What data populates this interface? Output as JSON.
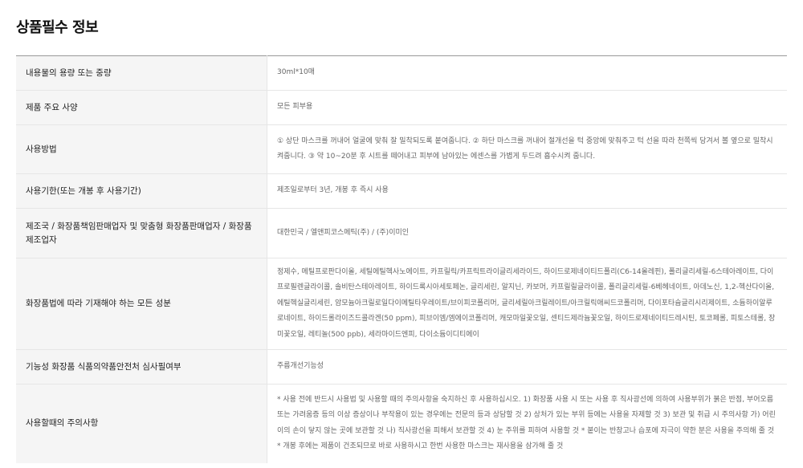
{
  "page": {
    "title": "상품필수 정보"
  },
  "rows": [
    {
      "label": "내용물의 용량 또는 중량",
      "value": "30ml*10매"
    },
    {
      "label": "제품 주요 사양",
      "value": "모든 피부용"
    },
    {
      "label": "사용방법",
      "value": "① 상단 마스크를 꺼내어 얼굴에 맞춰 잘 밀착되도록 붙여줍니다. ② 하단 마스크를 꺼내어 절개선을 턱 중앙에 맞춰주고 턱 선을 따라 천쪽씩 당겨서 볼 옆으로 밀착시켜줍니다. ③ 약 10~20분 후 시트를 떼어내고 피부에 남아있는 에센스를 가볍게 두드려 흡수시켜 줍니다."
    },
    {
      "label": "사용기한(또는 개봉 후 사용기간)",
      "value": "제조일로부터 3년, 개봉 후 즉시 사용"
    },
    {
      "label": "제조국 / 화장품책임판매업자 및 맞춤형 화장품판매업자 / 화장품제조업자",
      "value": "대한민국 / 엘앤피코스메틱(주) / (주)이미인"
    },
    {
      "label": "화장품법에 따라 기재해야 하는 모든 성분",
      "value": "정제수, 메틸프로판다이올, 세틸에틸헥사노에이트, 카프릴릭/카프릭트라이글리세라이드, 하이드로제네이티드폴리(C6-14올레핀), 폴리글리세릴-6스테아레이트, 다이프로필렌글라이콜, 솔비탄스테아레이트, 하이드록시아세토페논, 글리세린, 알지닌, 카보머, 카프릴릴글라이콜, 폴리글리세릴-6베헤네이트, 아데노신, 1,2-헥산다이올, 에틸헥실글리세린, 암모늄아크릴로일다이메틸타우레이트/브이피코폴리머, 글리세릴아크릴레이트/아크릴릭애씨드코폴리머, 다이포타슘글리시리제이트, 소듐하이알루로네이트, 하이드롤라이즈드콜라겐(50 ppm), 피브이엠/엠에이코폴리머, 캐모마일꽃오일, 센티드제라늄꽃오일, 하이드로제네이티드레시틴, 토코페롤, 피토스테롤, 장미꽃오일, 레티놀(500 ppb), 세라마이드엔피, 다이소듐이디티에이"
    },
    {
      "label": "기능성 화장품 식품의약품안전처 심사필여부",
      "value": "주름개선기능성"
    },
    {
      "label": "사용할때의 주의사항",
      "value": "* 사용 전에 반드시 사용법 및 사용할 때의 주의사항을 숙지하신 후 사용하십시오. 1) 화장품 사용 시 또는 사용 후 직사광선에 의하여 사용부위가 붉은 반점, 부어오름 또는 가려움증 등의 이상 증상이나 부작용이 있는 경우에는 전문의 등과 상담할 것 2) 상처가 있는 부위 등에는 사용을 자제할 것 3) 보관 및 취급 시 주의사항 가) 어린이의 손이 닿지 않는 곳에 보관할 것 나) 직사광선을 피해서 보관할 것 4) 눈 주위를 피하여 사용할 것 * 붙이는 반창고나 습포에 자극이 약한 분은 사용을 주의해 줄 것 * 개봉 후에는 제품이 건조되므로 바로 사용하시고 한번 사용한 마스크는 재사용을 삼가해 줄 것"
    }
  ]
}
